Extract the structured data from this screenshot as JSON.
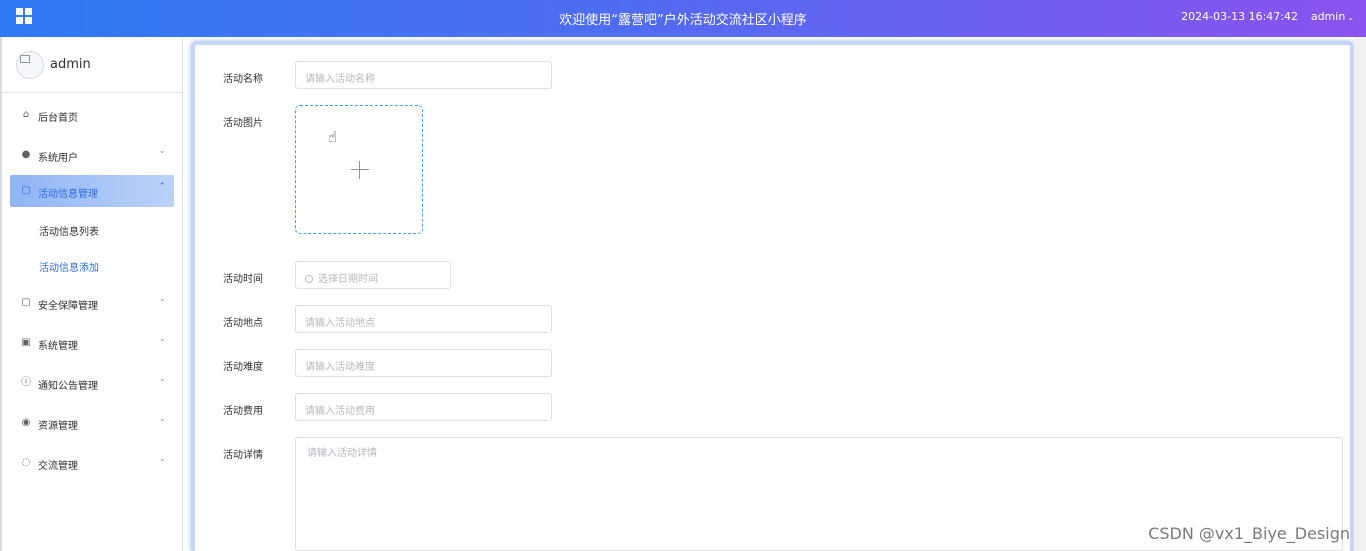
{
  "header": {
    "title": "欢迎使用“露营吧”户外活动交流社区小程序",
    "datetime": "2024-03-13 16:47:42",
    "user": "admin",
    "user_caret": "⌄"
  },
  "sidebar": {
    "username": "admin",
    "items": [
      {
        "label": "后台首页",
        "icon": "home-icon"
      },
      {
        "label": "系统用户",
        "icon": "user-icon"
      },
      {
        "label": "活动信息管理",
        "icon": "edit-icon"
      },
      {
        "label": "安全保障管理",
        "icon": "edit-icon"
      },
      {
        "label": "系统管理",
        "icon": "image-icon"
      },
      {
        "label": "通知公告管理",
        "icon": "info-icon"
      },
      {
        "label": "资源管理",
        "icon": "location-icon"
      },
      {
        "label": "交流管理",
        "icon": "chat-icon"
      }
    ],
    "subitems": [
      {
        "label": "活动信息列表"
      },
      {
        "label": "活动信息添加"
      }
    ]
  },
  "form": {
    "name": {
      "label": "活动名称",
      "placeholder": "请输入活动名称"
    },
    "image": {
      "label": "活动图片"
    },
    "time": {
      "label": "活动时间",
      "placeholder": "选择日期时间"
    },
    "location": {
      "label": "活动地点",
      "placeholder": "请输入活动地点"
    },
    "difficulty": {
      "label": "活动难度",
      "placeholder": "请输入活动难度"
    },
    "fee": {
      "label": "活动费用",
      "placeholder": "请输入活动费用"
    },
    "detail": {
      "label": "活动详情",
      "placeholder": "请输入活动详情"
    }
  },
  "watermark": "CSDN @vx1_Biye_Design",
  "colors": {
    "accent": "#2f6be0",
    "header_start": "#2f7af3",
    "header_end": "#8a52ee"
  }
}
